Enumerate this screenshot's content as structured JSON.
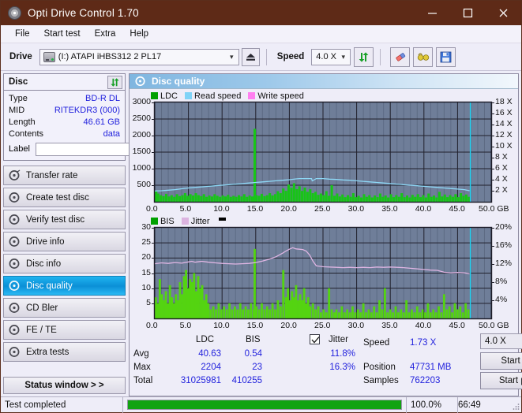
{
  "window": {
    "title": "Opti Drive Control 1.70",
    "icon": "disc-icon",
    "minimize": "minimize-icon",
    "maximize": "maximize-icon",
    "close": "close-icon",
    "titlebar_color": "#5e2a17"
  },
  "menu": {
    "items": [
      "File",
      "Start test",
      "Extra",
      "Help"
    ]
  },
  "toolbar": {
    "drive_label": "Drive",
    "drive_value": "(I:)  ATAPI iHBS312  2 PL17",
    "eject_icon": "eject-icon",
    "speed_label": "Speed",
    "speed_value": "4.0 X",
    "refresh_icon": "refresh-icon",
    "erase_icon": "eraser-icon",
    "tools_icon": "glasses-icon",
    "save_icon": "save-icon"
  },
  "disc": {
    "title": "Disc",
    "refresh_icon": "refresh-icon",
    "rows": [
      {
        "key": "Type",
        "value": "BD-R DL"
      },
      {
        "key": "MID",
        "value": "RITEKDR3 (000)"
      },
      {
        "key": "Length",
        "value": "46.61 GB"
      },
      {
        "key": "Contents",
        "value": "data"
      }
    ],
    "label_key": "Label",
    "label_value": "",
    "label_button_icon": "cd-icon"
  },
  "nav": {
    "items": [
      {
        "label": "Transfer rate",
        "icon": "disc-icon",
        "active": false
      },
      {
        "label": "Create test disc",
        "icon": "disc-icon",
        "active": false
      },
      {
        "label": "Verify test disc",
        "icon": "disc-icon",
        "active": false
      },
      {
        "label": "Drive info",
        "icon": "disc-icon",
        "active": false
      },
      {
        "label": "Disc info",
        "icon": "disc-icon",
        "active": false
      },
      {
        "label": "Disc quality",
        "icon": "disc-icon",
        "active": true
      },
      {
        "label": "CD Bler",
        "icon": "disc-icon",
        "active": false
      },
      {
        "label": "FE / TE",
        "icon": "disc-icon",
        "active": false
      },
      {
        "label": "Extra tests",
        "icon": "disc-icon",
        "active": false
      }
    ],
    "status_window": "Status window > >"
  },
  "panel": {
    "title": "Disc quality",
    "icon": "disc-icon"
  },
  "chart_data": [
    {
      "type": "area",
      "name": "ldc-chart",
      "title": "",
      "xlabel": "GB",
      "ylabel": "",
      "xlim": [
        0,
        50
      ],
      "xticks": [
        "0.0",
        "5.0",
        "10.0",
        "15.0",
        "20.0",
        "25.0",
        "30.0",
        "35.0",
        "40.0",
        "45.0",
        "50.0"
      ],
      "xtick_values": [
        0,
        5,
        10,
        15,
        20,
        25,
        30,
        35,
        40,
        45,
        50
      ],
      "x_unit": "GB",
      "ylim": [
        0,
        3000
      ],
      "yticks": [
        "500",
        "1000",
        "1500",
        "2000",
        "2500",
        "3000"
      ],
      "ytick_values": [
        500,
        1000,
        1500,
        2000,
        2500,
        3000
      ],
      "y2lim": [
        0,
        18
      ],
      "y2ticks": [
        "2 X",
        "4 X",
        "6 X",
        "8 X",
        "10 X",
        "12 X",
        "14 X",
        "16 X",
        "18 X"
      ],
      "y2tick_values": [
        2,
        4,
        6,
        8,
        10,
        12,
        14,
        16,
        18
      ],
      "grid": true,
      "legend": [
        {
          "name": "LDC",
          "color": "#00a000"
        },
        {
          "name": "Read speed",
          "color": "#7fd3f7"
        },
        {
          "name": "Write speed",
          "color": "#ff7ff0"
        }
      ],
      "series": [
        {
          "name": "LDC",
          "color": "#18c418",
          "kind": "bars",
          "x": [
            0.2,
            0.5,
            0.9,
            1.3,
            1.7,
            2.1,
            2.5,
            2.9,
            3.3,
            3.7,
            4.1,
            4.5,
            4.9,
            5.3,
            5.7,
            6.1,
            6.5,
            6.9,
            7.3,
            7.7,
            8.1,
            8.5,
            8.9,
            9.3,
            9.7,
            10.1,
            10.5,
            10.9,
            11.3,
            11.7,
            12.1,
            12.5,
            12.9,
            13.3,
            13.7,
            14.1,
            14.5,
            14.85,
            15.1,
            15.5,
            15.9,
            16.3,
            16.7,
            17.1,
            17.5,
            17.9,
            18.3,
            18.7,
            19.1,
            19.5,
            19.9,
            20.3,
            20.7,
            21.1,
            21.5,
            21.9,
            22.3,
            22.7,
            23.1,
            23.5,
            23.9,
            24.3,
            24.7,
            25.1,
            25.5,
            25.9,
            26.3,
            26.7,
            27.1,
            27.5,
            27.9,
            28.3,
            28.7,
            29.1,
            29.5,
            29.9,
            30.3,
            30.7,
            31.1,
            31.5,
            31.9,
            32.3,
            32.7,
            33.1,
            33.5,
            33.9,
            34.3,
            34.7,
            35.1,
            35.5,
            35.9,
            36.3,
            36.7,
            37.1,
            37.5,
            37.9,
            38.3,
            38.7,
            39.1,
            39.5,
            39.9,
            40.3,
            40.7,
            41.1,
            41.5,
            41.9,
            42.3,
            42.7,
            43.1,
            43.5,
            43.9,
            44.3,
            44.7,
            45.1,
            45.5,
            45.9,
            46.3,
            46.7
          ],
          "y": [
            330,
            250,
            200,
            170,
            240,
            160,
            200,
            150,
            230,
            170,
            200,
            260,
            180,
            230,
            190,
            260,
            200,
            170,
            230,
            150,
            190,
            160,
            230,
            180,
            150,
            190,
            160,
            210,
            150,
            180,
            150,
            200,
            160,
            230,
            150,
            190,
            160,
            2204,
            200,
            180,
            240,
            170,
            200,
            260,
            190,
            230,
            320,
            260,
            400,
            330,
            520,
            420,
            560,
            380,
            470,
            330,
            430,
            300,
            380,
            260,
            300,
            210,
            250,
            200,
            320,
            180,
            500,
            180,
            250,
            160,
            220,
            140,
            200,
            150,
            260,
            140,
            180,
            130,
            230,
            150,
            200,
            130,
            190,
            140,
            250,
            150,
            190,
            130,
            230,
            140,
            200,
            150,
            260,
            140,
            190,
            130,
            210,
            150,
            230,
            140,
            200,
            130,
            250,
            150,
            190,
            130,
            300,
            160,
            220,
            140,
            200,
            150,
            230,
            140,
            260,
            180,
            220,
            150
          ]
        },
        {
          "name": "Read speed",
          "color": "#8ed9f7",
          "kind": "line",
          "x": [
            0,
            1,
            2,
            3,
            4,
            5,
            6,
            7,
            8,
            9,
            10,
            11,
            12,
            13,
            14,
            15,
            16,
            17,
            18,
            19,
            20,
            21,
            21.5,
            22,
            23,
            23.3,
            23.4,
            24,
            25,
            26,
            27,
            28,
            29,
            30,
            31,
            32,
            33,
            34,
            35,
            36,
            37,
            38,
            39,
            40,
            41,
            42,
            43,
            44,
            45,
            46,
            46.8
          ],
          "y": [
            1.95,
            2.0,
            2.1,
            2.2,
            2.35,
            2.5,
            2.6,
            2.7,
            2.8,
            2.9,
            3.0,
            3.1,
            3.2,
            3.3,
            3.4,
            3.5,
            3.6,
            3.7,
            3.8,
            3.9,
            4.0,
            4.15,
            4.2,
            4.2,
            4.2,
            4.2,
            3.8,
            4.2,
            4.2,
            4.1,
            4.05,
            3.95,
            3.9,
            3.8,
            3.7,
            3.6,
            3.5,
            3.4,
            3.3,
            3.2,
            3.1,
            3.0,
            2.9,
            2.8,
            2.7,
            2.6,
            2.5,
            2.4,
            2.3,
            2.2,
            2.0
          ]
        }
      ],
      "marker_line": {
        "x": 46.9,
        "color": "#22d6f5"
      }
    },
    {
      "type": "area",
      "name": "bis-jitter-chart",
      "title": "",
      "xlabel": "GB",
      "xlim": [
        0,
        50
      ],
      "xticks": [
        "0.0",
        "5.0",
        "10.0",
        "15.0",
        "20.0",
        "25.0",
        "30.0",
        "35.0",
        "40.0",
        "45.0",
        "50.0"
      ],
      "xtick_values": [
        0,
        5,
        10,
        15,
        20,
        25,
        30,
        35,
        40,
        45,
        50
      ],
      "x_unit": "GB",
      "ylim": [
        0,
        30
      ],
      "yticks": [
        "5",
        "10",
        "15",
        "20",
        "25",
        "30"
      ],
      "ytick_values": [
        5,
        10,
        15,
        20,
        25,
        30
      ],
      "y2lim": [
        0,
        20
      ],
      "y2ticks": [
        "4%",
        "8%",
        "12%",
        "16%",
        "20%"
      ],
      "y2tick_values": [
        4,
        8,
        12,
        16,
        20
      ],
      "grid": true,
      "legend": [
        {
          "name": "BIS",
          "color": "#00a000"
        },
        {
          "name": "Jitter",
          "color": "#dcb4e0"
        }
      ],
      "series": [
        {
          "name": "BIS",
          "color": "#54d411",
          "kind": "bars",
          "x": [
            0.15,
            0.45,
            0.75,
            1.05,
            1.35,
            1.65,
            1.95,
            2.25,
            2.55,
            2.85,
            3.15,
            3.45,
            3.75,
            4.05,
            4.35,
            4.65,
            4.95,
            5.25,
            5.55,
            5.85,
            6.15,
            6.45,
            6.75,
            7.05,
            7.35,
            7.65,
            7.95,
            8.3,
            8.7,
            9.1,
            9.5,
            9.9,
            10.3,
            10.7,
            11.1,
            11.5,
            11.9,
            12.3,
            12.7,
            13.1,
            13.5,
            13.9,
            14.3,
            14.7,
            14.85,
            15.1,
            15.5,
            15.9,
            16.3,
            16.7,
            17.1,
            17.5,
            17.9,
            18.3,
            18.7,
            19.1,
            19.5,
            19.8,
            20.1,
            20.4,
            20.7,
            21.0,
            21.3,
            21.6,
            21.9,
            22.2,
            22.5,
            22.8,
            23.1,
            23.5,
            23.9,
            24.3,
            24.7,
            25.1,
            25.5,
            25.9,
            26.3,
            26.7,
            27.0,
            27.4,
            27.8,
            28.2,
            28.6,
            29.0,
            29.4,
            29.8,
            30.2,
            30.6,
            31.0,
            31.4,
            31.8,
            32.2,
            32.6,
            33.0,
            33.4,
            33.8,
            34.2,
            34.6,
            35.0,
            35.4,
            35.8,
            36.2,
            36.6,
            37.0,
            37.4,
            37.8,
            38.2,
            38.6,
            39.0,
            39.4,
            39.8,
            40.2,
            40.6,
            41.0,
            41.4,
            41.8,
            42.2,
            42.6,
            43.0,
            43.4,
            43.8,
            44.2,
            44.6,
            45.0,
            45.4,
            45.8,
            46.2,
            46.6
          ],
          "y": [
            7,
            5,
            13,
            8,
            6,
            9,
            5,
            11,
            7,
            5,
            8,
            6,
            12,
            8,
            14,
            16,
            10,
            13,
            12,
            15,
            9,
            14,
            10,
            11,
            6,
            8,
            5,
            3,
            4,
            3,
            5,
            3,
            4,
            3,
            5,
            3,
            4,
            3,
            5,
            3,
            4,
            3,
            5,
            3,
            23,
            4,
            3,
            5,
            3,
            4,
            3,
            5,
            3,
            6,
            4,
            16,
            7,
            10,
            6,
            9,
            7,
            11,
            6,
            8,
            6,
            10,
            5,
            7,
            4,
            5,
            3,
            4,
            2,
            3,
            2,
            10,
            3,
            2,
            3,
            2,
            4,
            2,
            3,
            2,
            4,
            2,
            3,
            2,
            5,
            2,
            3,
            2,
            4,
            2,
            6,
            3,
            10,
            2,
            3,
            2,
            4,
            2,
            3,
            2,
            6,
            2,
            3,
            2,
            4,
            2,
            3,
            2,
            5,
            2,
            3,
            2,
            4,
            2,
            8,
            3,
            4,
            2,
            5,
            3,
            4,
            2,
            5,
            3
          ]
        },
        {
          "name": "Jitter",
          "color": "#e0b6e4",
          "kind": "line",
          "x": [
            0,
            1,
            2,
            3,
            4,
            5,
            5.5,
            6,
            7,
            8,
            9,
            10,
            11,
            12,
            13,
            14,
            15,
            16,
            17,
            18,
            19,
            19.5,
            20,
            20.5,
            21,
            21.5,
            22,
            22.5,
            23,
            23.5,
            24,
            25,
            26,
            27,
            28,
            29,
            30,
            31,
            32,
            33,
            34,
            35,
            36,
            37,
            38,
            39,
            40,
            41,
            42,
            43,
            44,
            45,
            46,
            46.8
          ],
          "y": [
            18.1,
            18.4,
            18.2,
            18.5,
            18.3,
            18.7,
            18.9,
            18.6,
            18.9,
            18.6,
            18.4,
            18.2,
            18.1,
            18.0,
            18.1,
            18.2,
            18.5,
            19.0,
            19.6,
            20.4,
            21.6,
            22.3,
            22.9,
            23.4,
            23.0,
            22.9,
            22.8,
            22.3,
            21.0,
            19.0,
            17.4,
            17.1,
            17.0,
            16.9,
            16.8,
            16.9,
            16.8,
            16.9,
            16.8,
            17.0,
            16.9,
            17.0,
            16.9,
            16.8,
            16.6,
            16.4,
            16.2,
            16.0,
            15.9,
            15.3,
            15.1,
            15.2,
            15.1,
            14.8
          ]
        }
      ],
      "marker_line": {
        "x": 46.9,
        "color": "#22d6f5"
      }
    }
  ],
  "stats": {
    "col_headers": [
      "LDC",
      "BIS"
    ],
    "jitter_label": "Jitter",
    "jitter_checked": true,
    "rows": [
      {
        "label": "Avg",
        "ldc": "40.63",
        "bis": "0.54",
        "jitter": "11.8%"
      },
      {
        "label": "Max",
        "ldc": "2204",
        "bis": "23",
        "jitter": "16.3%"
      },
      {
        "label": "Total",
        "ldc": "31025981",
        "bis": "410255",
        "jitter": ""
      }
    ],
    "speed_label": "Speed",
    "speed_value": "1.73 X",
    "position_label": "Position",
    "position_value": "47731 MB",
    "samples_label": "Samples",
    "samples_value": "762203",
    "speed_select": "4.0 X",
    "start_full": "Start full",
    "start_part": "Start part"
  },
  "statusbar": {
    "message": "Test completed",
    "progress_percent": 100,
    "progress_text": "100.0%",
    "elapsed": "66:49",
    "progress_color": "#12a312"
  }
}
